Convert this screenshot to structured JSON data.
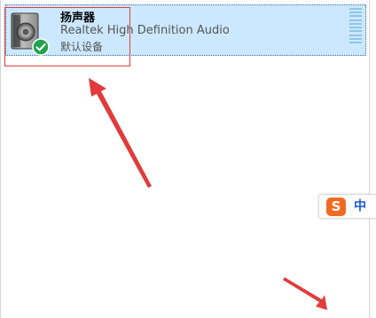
{
  "device": {
    "name": "扬声器",
    "description": "Realtek High Definition Audio",
    "status": "默认设备",
    "icon": "speaker-icon",
    "status_icon": "check-circle-icon"
  },
  "ime": {
    "logo_letter": "S",
    "mode": "中",
    "logo_color": "#f26a21",
    "icon": "sogou-ime-icon"
  },
  "colors": {
    "selection": "#cce8ff",
    "annotation": "#e23b3b",
    "default_badge": "#1fa34a"
  }
}
